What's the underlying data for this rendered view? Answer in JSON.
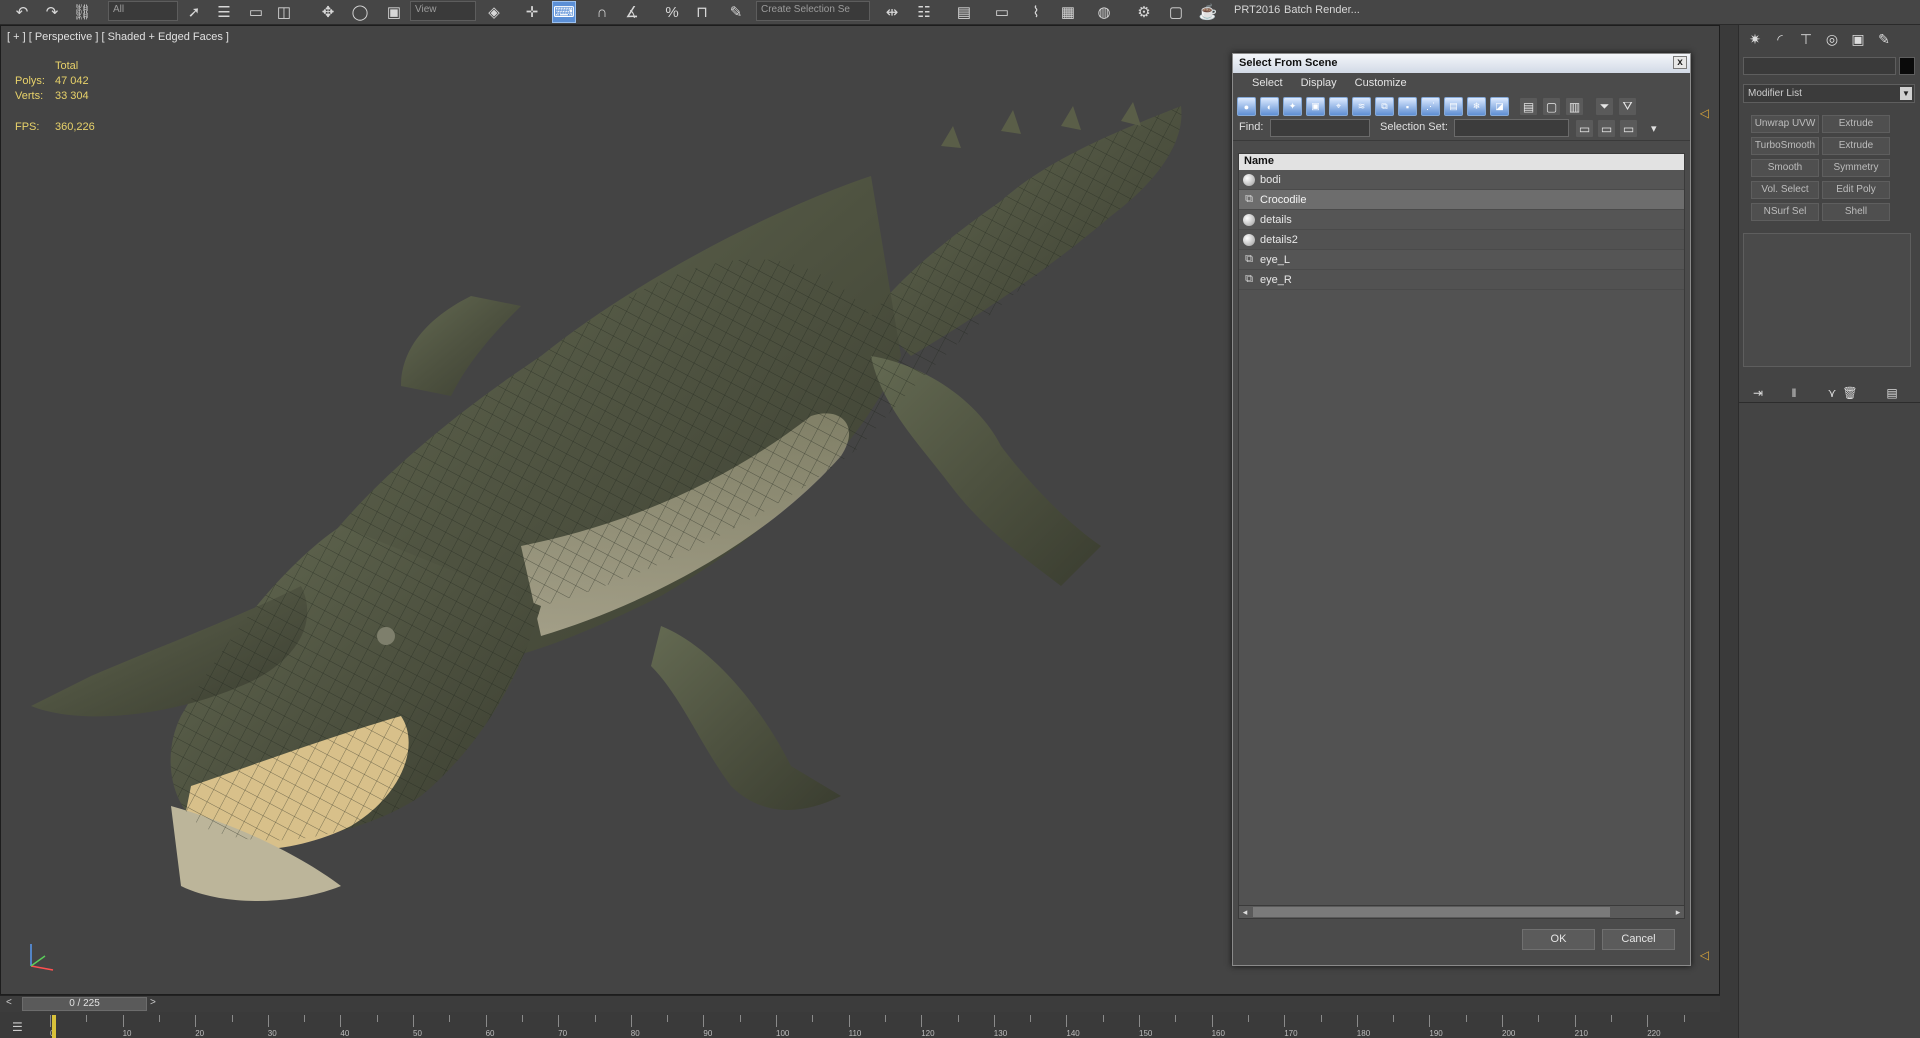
{
  "toolbar": {
    "selection_filter": "All",
    "ref_coord": "View",
    "named_selection": "Create Selection Se",
    "prt_label": "PRT2016",
    "batch_render_label": "Batch Render..."
  },
  "viewport": {
    "label": "[ + ] [ Perspective ] [ Shaded + Edged Faces ]",
    "stats": {
      "total_header": "Total",
      "polys_label": "Polys:",
      "polys_value": "47 042",
      "verts_label": "Verts:",
      "verts_value": "33 304",
      "fps_label": "FPS:",
      "fps_value": "360,226"
    },
    "accent_color": "#e8d26a"
  },
  "dialog": {
    "title": "Select From Scene",
    "close_glyph": "x",
    "menu": [
      "Select",
      "Display",
      "Customize"
    ],
    "find_label": "Find:",
    "selection_set_label": "Selection Set:",
    "column_header": "Name",
    "rows": [
      {
        "name": "bodi",
        "icon": "sphere",
        "selected": false
      },
      {
        "name": "Crocodile",
        "icon": "group",
        "selected": true
      },
      {
        "name": "details",
        "icon": "sphere",
        "selected": false
      },
      {
        "name": "details2",
        "icon": "sphere",
        "selected": false
      },
      {
        "name": "eye_L",
        "icon": "group",
        "selected": false
      },
      {
        "name": "eye_R",
        "icon": "group",
        "selected": false
      }
    ],
    "ok_label": "OK",
    "cancel_label": "Cancel"
  },
  "command_panel": {
    "modifier_list_label": "Modifier List",
    "modifier_buttons": [
      "Unwrap UVW",
      "Extrude",
      "TurboSmooth",
      "Extrude",
      "Smooth",
      "Symmetry",
      "Vol. Select",
      "Edit Poly",
      "NSurf Sel",
      "Shell"
    ]
  },
  "timeline": {
    "frame_display": "0 / 225",
    "prev_glyph": "<",
    "next_glyph": ">",
    "ticks": [
      "0",
      "10",
      "20",
      "30",
      "40",
      "50",
      "60",
      "70",
      "80",
      "90",
      "100",
      "110",
      "120",
      "130",
      "140",
      "150",
      "160",
      "170",
      "180",
      "190",
      "200",
      "210",
      "220"
    ]
  }
}
